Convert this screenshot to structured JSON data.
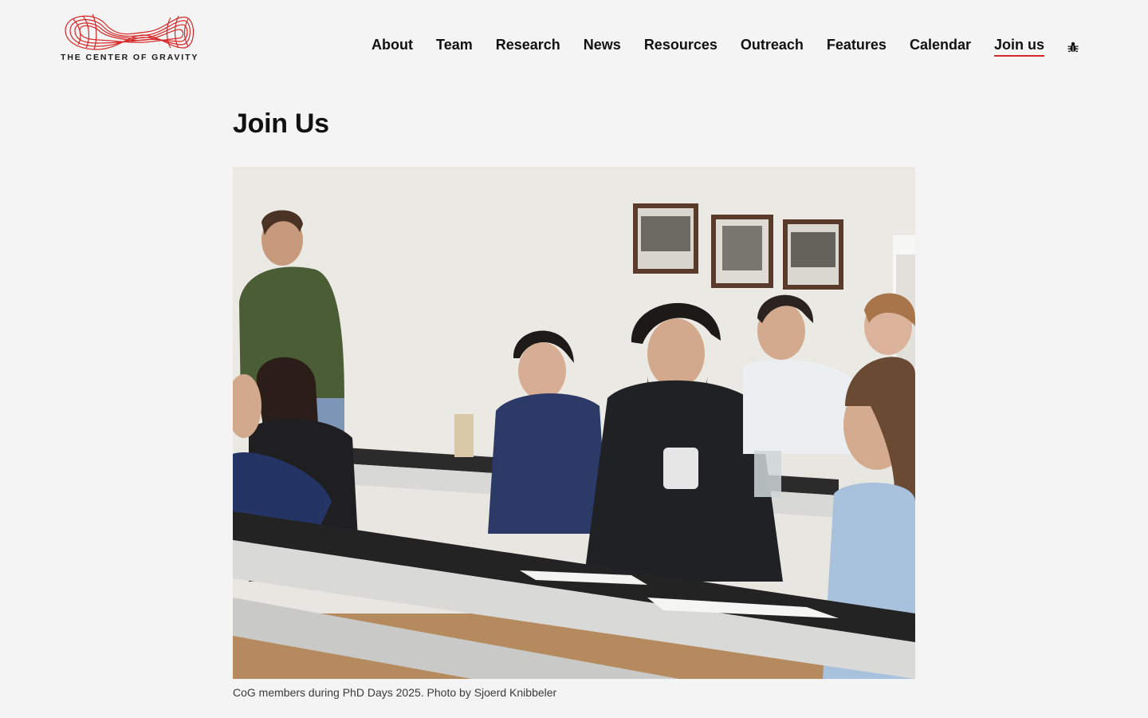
{
  "logo": {
    "text": "THE CENTER OF GRAVITY",
    "icon": "gravity-wave-logo",
    "color": "#d62828"
  },
  "nav": {
    "items": [
      {
        "label": "About",
        "active": false
      },
      {
        "label": "Team",
        "active": false
      },
      {
        "label": "Research",
        "active": false
      },
      {
        "label": "News",
        "active": false
      },
      {
        "label": "Resources",
        "active": false
      },
      {
        "label": "Outreach",
        "active": false
      },
      {
        "label": "Features",
        "active": false
      },
      {
        "label": "Calendar",
        "active": false
      },
      {
        "label": "Join us",
        "active": true
      }
    ],
    "extra_icon": "bug-icon",
    "active_underline_color": "#d62828"
  },
  "page": {
    "title": "Join Us",
    "caption": "CoG members during PhD Days 2025. Photo by Sjoerd Knibbeler"
  }
}
